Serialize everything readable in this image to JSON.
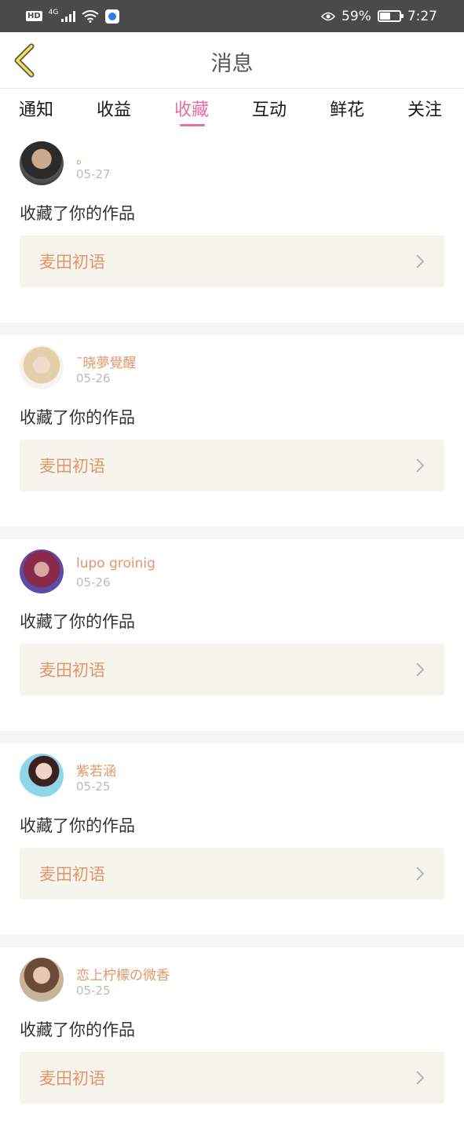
{
  "status_bar": {
    "hd": "HD",
    "network": "4G",
    "battery_percent": "59%",
    "battery_level": 0.59,
    "time": "7:27",
    "icons": [
      "hd-icon",
      "signal-icon",
      "wifi-icon",
      "baidu-app-icon",
      "eye-icon",
      "battery-icon"
    ]
  },
  "header": {
    "title": "消息",
    "back_icon": "chevron-left-icon",
    "accent": "#e56fa8"
  },
  "tabs": [
    {
      "label": "通知",
      "active": false
    },
    {
      "label": "收益",
      "active": false
    },
    {
      "label": "收藏",
      "active": true
    },
    {
      "label": "互动",
      "active": false
    },
    {
      "label": "鲜花",
      "active": false
    },
    {
      "label": "关注",
      "active": false
    }
  ],
  "items": [
    {
      "username": "。",
      "date": "05-27",
      "action": "收藏了你的作品",
      "work_title": "麦田初语"
    },
    {
      "username": "ˉ晓夢覺醒",
      "date": "05-26",
      "action": "收藏了你的作品",
      "work_title": "麦田初语"
    },
    {
      "username": "lupo groinig",
      "date": "05-26",
      "action": "收藏了你的作品",
      "work_title": "麦田初语"
    },
    {
      "username": "紫若涵",
      "date": "05-25",
      "action": "收藏了你的作品",
      "work_title": "麦田初语"
    },
    {
      "username": "恋上柠檬の微香",
      "date": "05-25",
      "action": "收藏了你的作品",
      "work_title": "麦田初语"
    }
  ],
  "colors": {
    "username": "#e3966a",
    "card_bg": "#f5f5ee",
    "status_bar_bg": "#4a4a4a"
  }
}
